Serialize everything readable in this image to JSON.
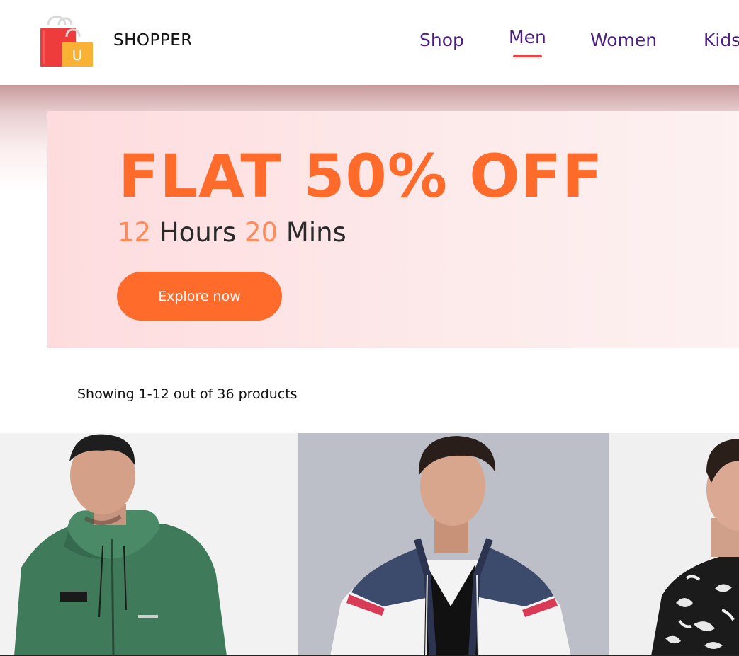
{
  "header": {
    "brand": "SHOPPER",
    "logo_icon": "shopping-bag-icon",
    "logo_letter": "U",
    "nav": [
      {
        "label": "Shop",
        "active": false
      },
      {
        "label": "Men",
        "active": true
      },
      {
        "label": "Women",
        "active": false
      },
      {
        "label": "Kids",
        "active": false
      }
    ]
  },
  "hero": {
    "headline": "FLAT 50% OFF",
    "timer": {
      "hours": "12",
      "hours_label": "Hours",
      "mins": "20",
      "mins_label": "Mins"
    },
    "cta_label": "Explore now"
  },
  "results": {
    "summary": "Showing 1-12 out of 36 products"
  },
  "products": [
    {
      "image": "green-hoodie-model"
    },
    {
      "image": "navy-white-puffer-jacket-model"
    },
    {
      "image": "black-white-printed-jacket-model"
    }
  ],
  "colors": {
    "accent": "#ff6b2b",
    "nav_text": "#4a1e84",
    "active_underline": "#ee4444",
    "banner_bg": "#fde4e5"
  }
}
